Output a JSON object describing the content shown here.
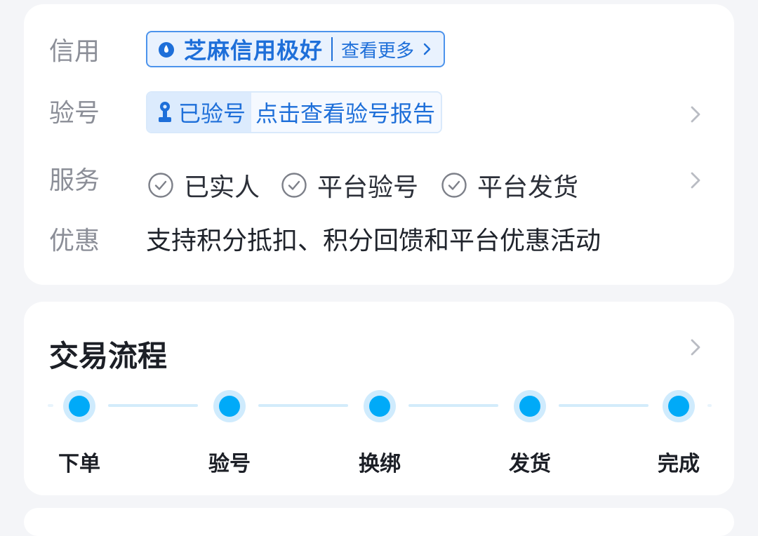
{
  "info": {
    "credit": {
      "label": "信用",
      "badge_text": "芝麻信用极好",
      "more_text": "查看更多",
      "icon": "sesame-drop-icon"
    },
    "verify": {
      "label": "验号",
      "status_text": "已验号",
      "report_text": "点击查看验号报告",
      "icon": "person-stamp-icon"
    },
    "service": {
      "label": "服务",
      "items": [
        "已实人",
        "平台验号",
        "平台发货"
      ],
      "icon": "check-circle-icon"
    },
    "promo": {
      "label": "优惠",
      "text": "支持积分抵扣、积分回馈和平台优惠活动"
    }
  },
  "flow": {
    "title": "交易流程",
    "steps": [
      "下单",
      "验号",
      "换绑",
      "发货",
      "完成"
    ]
  },
  "colors": {
    "accent_blue": "#1e6fd9",
    "step_dot": "#00aaf8",
    "background": "#f4f5f8"
  }
}
